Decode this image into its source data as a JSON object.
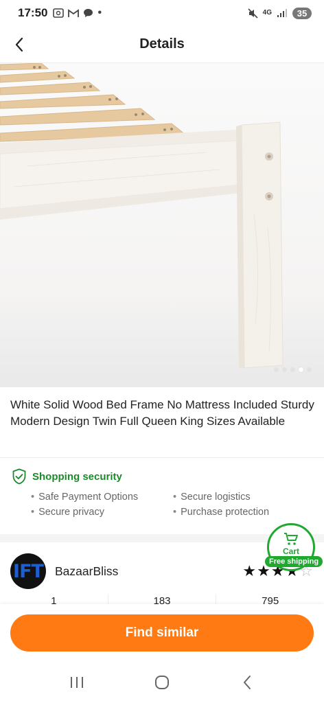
{
  "status_bar": {
    "time": "17:50",
    "network": "4G",
    "battery": "35",
    "icons_left": [
      "screenshot-icon",
      "gmail-icon",
      "chat-icon",
      "dot-icon"
    ],
    "icons_right": [
      "mute-icon",
      "network-icon",
      "signal-icon",
      "battery-icon"
    ]
  },
  "header": {
    "title": "Details"
  },
  "product": {
    "image_alt": "white-wood-bed-frame",
    "carousel_total": 5,
    "carousel_active": 4,
    "title": "White Solid Wood Bed Frame No Mattress Included Sturdy Modern Design Twin Full Queen King Sizes Available"
  },
  "security": {
    "title": "Shopping security",
    "items": [
      "Safe Payment Options",
      "Secure logistics",
      "Secure privacy",
      "Purchase protection"
    ]
  },
  "seller": {
    "avatar_text": "IFT",
    "name": "BazaarBliss",
    "rating": 4,
    "rating_max": 5,
    "stats": [
      "1",
      "183",
      "795"
    ]
  },
  "cart_badge": {
    "label": "Cart",
    "free_shipping": "Free shipping"
  },
  "actions": {
    "find_similar": "Find similar"
  },
  "colors": {
    "accent_orange": "#ff7a12",
    "security_green": "#1c8a2b",
    "cart_green": "#21a831"
  }
}
